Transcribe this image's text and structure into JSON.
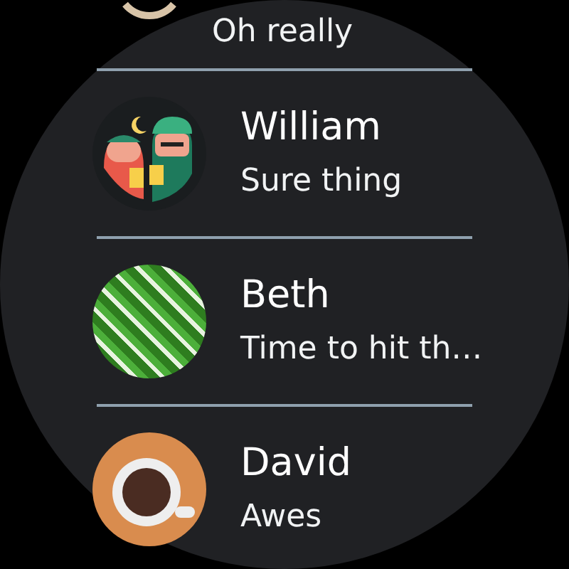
{
  "conversations": [
    {
      "kind": "partial",
      "preview": "Oh really"
    },
    {
      "kind": "beer-friends",
      "name": "William",
      "preview": "Sure thing"
    },
    {
      "kind": "fern-photo",
      "name": "Beth",
      "preview": "Time to hit th…"
    },
    {
      "kind": "coffee",
      "name": "David",
      "preview": "Awes"
    }
  ]
}
